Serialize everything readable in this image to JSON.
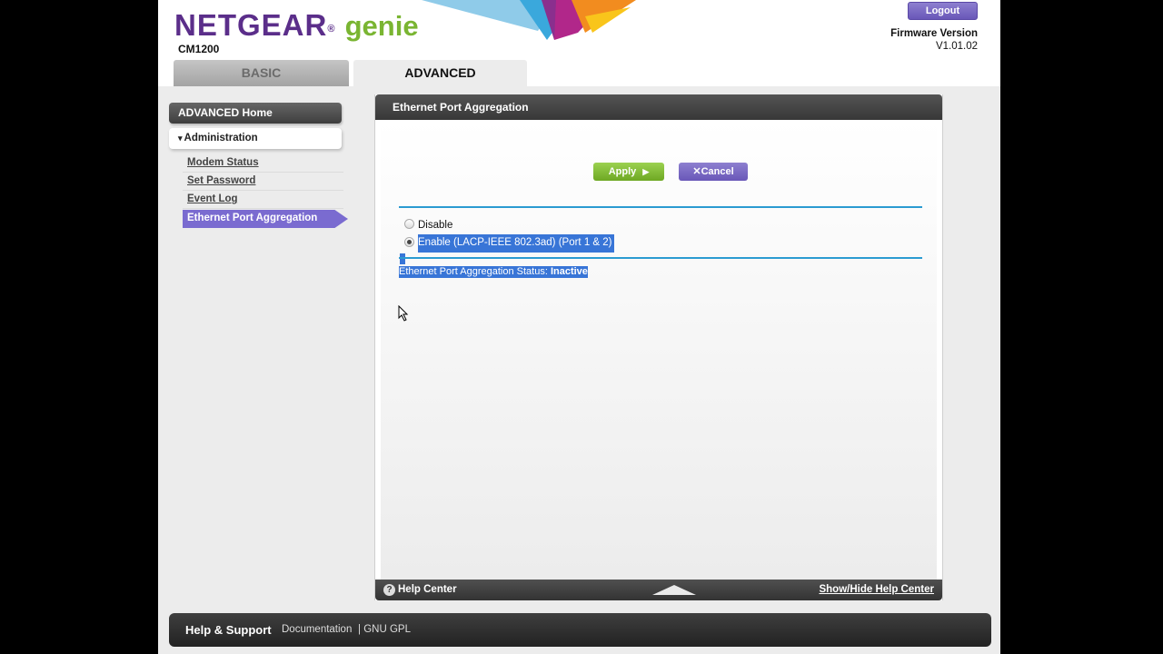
{
  "header": {
    "brand_main": "NETGEAR",
    "brand_reg": "®",
    "brand_sub": "genie",
    "model": "CM1200",
    "logout_label": "Logout",
    "firmware_label": "Firmware Version",
    "firmware_value": "V1.01.02"
  },
  "tabs": [
    {
      "label": "BASIC",
      "active": false
    },
    {
      "label": "ADVANCED",
      "active": true
    }
  ],
  "sidebar": {
    "home_label": "ADVANCED Home",
    "section_arrow": "▾",
    "section_label": "Administration",
    "items": [
      {
        "label": "Modem Status",
        "active": false
      },
      {
        "label": "Set Password",
        "active": false
      },
      {
        "label": "Event Log",
        "active": false
      },
      {
        "label": "Ethernet Port Aggregation",
        "active": true
      }
    ]
  },
  "panel": {
    "title": "Ethernet Port Aggregation",
    "apply_label": "Apply",
    "apply_icon": "▶",
    "cancel_icon": "✕",
    "cancel_label": "Cancel",
    "options": [
      {
        "label": "Disable",
        "selected": false
      },
      {
        "label": "Enable (LACP-IEEE 802.3ad) (Port 1 & 2)",
        "selected": true
      }
    ],
    "status_label": "Ethernet Port Aggregation Status:",
    "status_value": "Inactive"
  },
  "help_bar": {
    "icon": "?",
    "title": "Help Center",
    "toggle_label": "Show/Hide Help Center"
  },
  "footer": {
    "title": "Help & Support",
    "documentation": "Documentation",
    "separator": "|",
    "gpl": "GNU GPL"
  },
  "colors": {
    "brand_purple": "#5b2e8a",
    "brand_green": "#7ab532",
    "accent_purple": "#7a6bd0",
    "apply_green": "#7cb82f",
    "rule_blue": "#2b9bd1",
    "selection_blue": "#3875d7"
  }
}
